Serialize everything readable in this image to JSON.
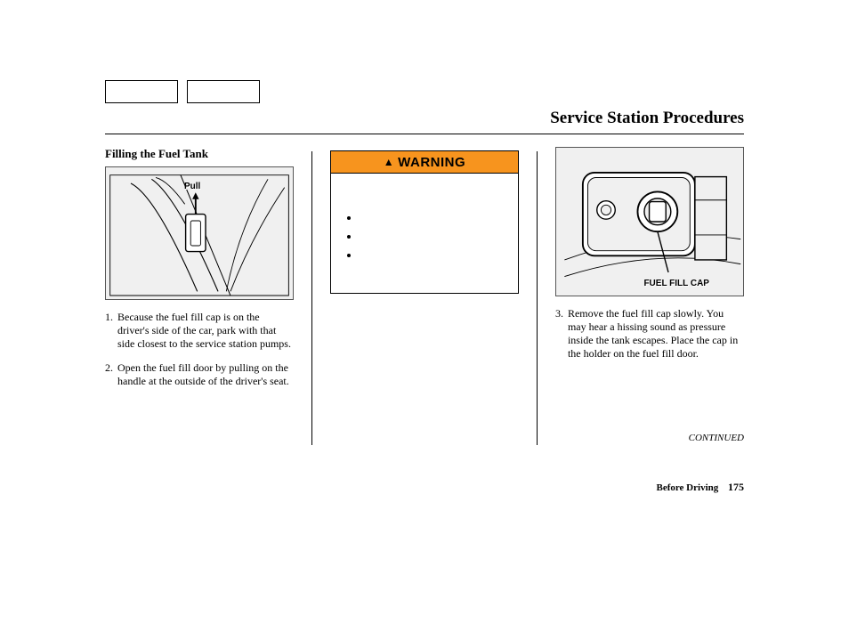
{
  "title": "Service Station Procedures",
  "subheading": "Filling the Fuel Tank",
  "illustration1": {
    "label_pull": "Pull"
  },
  "illustration3": {
    "label_cap": "FUEL FILL CAP"
  },
  "steps": [
    {
      "n": "1.",
      "text": "Because the fuel fill cap is on the driver's side of the car, park with that side closest to the service station pumps."
    },
    {
      "n": "2.",
      "text": "Open the fuel fill door by pulling on the handle at the outside of the driver's seat."
    },
    {
      "n": "3.",
      "text": "Remove the fuel fill cap slowly. You may hear a hissing sound as pressure inside the tank escapes. Place the cap in the holder on the fuel fill door."
    }
  ],
  "warning": {
    "header": "WARNING",
    "bullets": [
      "",
      "",
      ""
    ]
  },
  "continued": "CONTINUED",
  "footer": {
    "section": "Before Driving",
    "page": "175"
  }
}
